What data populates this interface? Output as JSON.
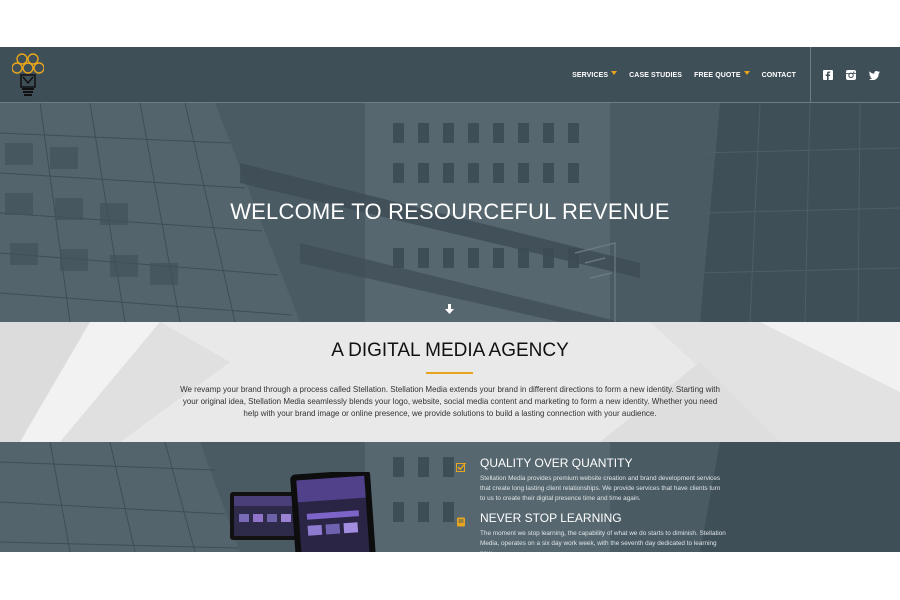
{
  "header": {
    "nav": [
      {
        "label": "SERVICES",
        "dropdown": true
      },
      {
        "label": "CASE STUDIES",
        "dropdown": false
      },
      {
        "label": "FREE QUOTE",
        "dropdown": true
      },
      {
        "label": "CONTACT",
        "dropdown": false
      }
    ],
    "social": [
      "facebook-icon",
      "instagram-icon",
      "twitter-icon"
    ]
  },
  "hero": {
    "title": "WELCOME TO RESOURCEFUL REVENUE"
  },
  "agency": {
    "title": "A DIGITAL MEDIA AGENCY",
    "text": "We revamp your brand through a process called Stellation. Stellation Media extends your brand in different directions to form a new identity. Starting with your original idea, Stellation Media seamlessly blends your logo, website, social media content and marketing to form a new identity. Whether you need help with your brand image or online presence, we provide solutions to build a lasting connection with your audience."
  },
  "features": [
    {
      "icon": "checkbox-icon",
      "title": "QUALITY OVER QUANTITY",
      "text": "Stellation Media provides premium website creation and brand development services that create long lasting client relationships. We provide services that have clients turn to us to create their digital presence time and time again."
    },
    {
      "icon": "book-icon",
      "title": "NEVER STOP LEARNING",
      "text": "The moment we stop learning, the capability of what we do starts to diminish. Stellation Media, operates on a six day work week, with the seventh day dedicated to learning new"
    }
  ],
  "colors": {
    "accent": "#e6a51c",
    "header_bg": "#3f4f58",
    "overlay": "#465760",
    "band_bg": "#e8e8e8"
  }
}
